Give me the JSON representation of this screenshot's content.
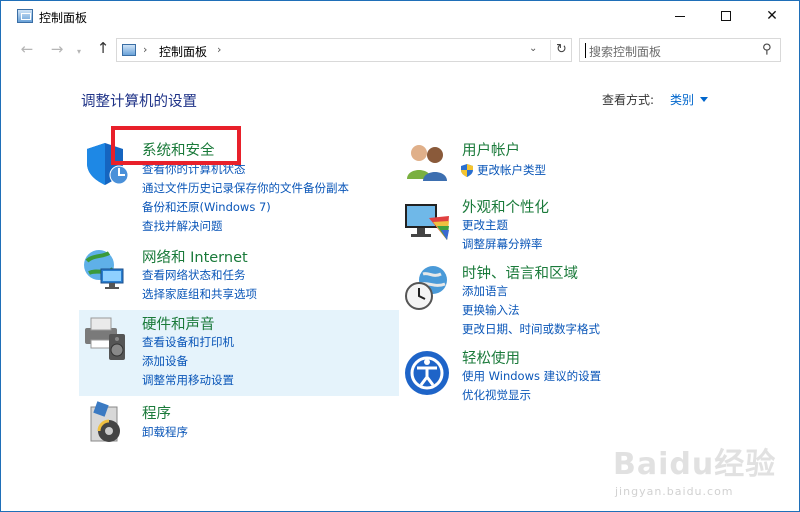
{
  "window": {
    "title": "控制面板"
  },
  "navigation": {
    "back_icon": "arrow-left",
    "forward_icon": "arrow-right",
    "up_icon": "arrow-up",
    "breadcrumb": [
      "控制面板"
    ],
    "search_placeholder": "搜索控制面板"
  },
  "main": {
    "heading": "调整计算机的设置",
    "view_by_label": "查看方式:",
    "view_by_value": "类别",
    "categories": [
      {
        "title": "系统和安全",
        "icon": "shield-icon",
        "links": [
          "查看你的计算机状态",
          "通过文件历史记录保存你的文件备份副本",
          "备份和还原(Windows 7)",
          "查找并解决问题"
        ]
      },
      {
        "title": "网络和 Internet",
        "icon": "globe-network-icon",
        "links": [
          "查看网络状态和任务",
          "选择家庭组和共享选项"
        ]
      },
      {
        "title": "硬件和声音",
        "icon": "printer-speaker-icon",
        "links": [
          "查看设备和打印机",
          "添加设备",
          "调整常用移动设置"
        ]
      },
      {
        "title": "程序",
        "icon": "programs-icon",
        "links": [
          "卸载程序"
        ]
      },
      {
        "title": "用户帐户",
        "icon": "users-icon",
        "links": [
          "更改帐户类型"
        ]
      },
      {
        "title": "外观和个性化",
        "icon": "monitor-palette-icon",
        "links": [
          "更改主题",
          "调整屏幕分辨率"
        ]
      },
      {
        "title": "时钟、语言和区域",
        "icon": "globe-clock-icon",
        "links": [
          "添加语言",
          "更换输入法",
          "更改日期、时间或数字格式"
        ]
      },
      {
        "title": "轻松使用",
        "icon": "ease-of-access-icon",
        "links": [
          "使用 Windows 建议的设置",
          "优化视觉显示"
        ]
      }
    ]
  },
  "watermark": {
    "logo": "Baidu经验",
    "url": "jingyan.baidu.com"
  },
  "colors": {
    "heading": "#1e3287",
    "category_title": "#1a7a3a",
    "link": "#0a56b8",
    "highlight_box": "#e8202a",
    "hover_bg": "#e5f3fb"
  }
}
